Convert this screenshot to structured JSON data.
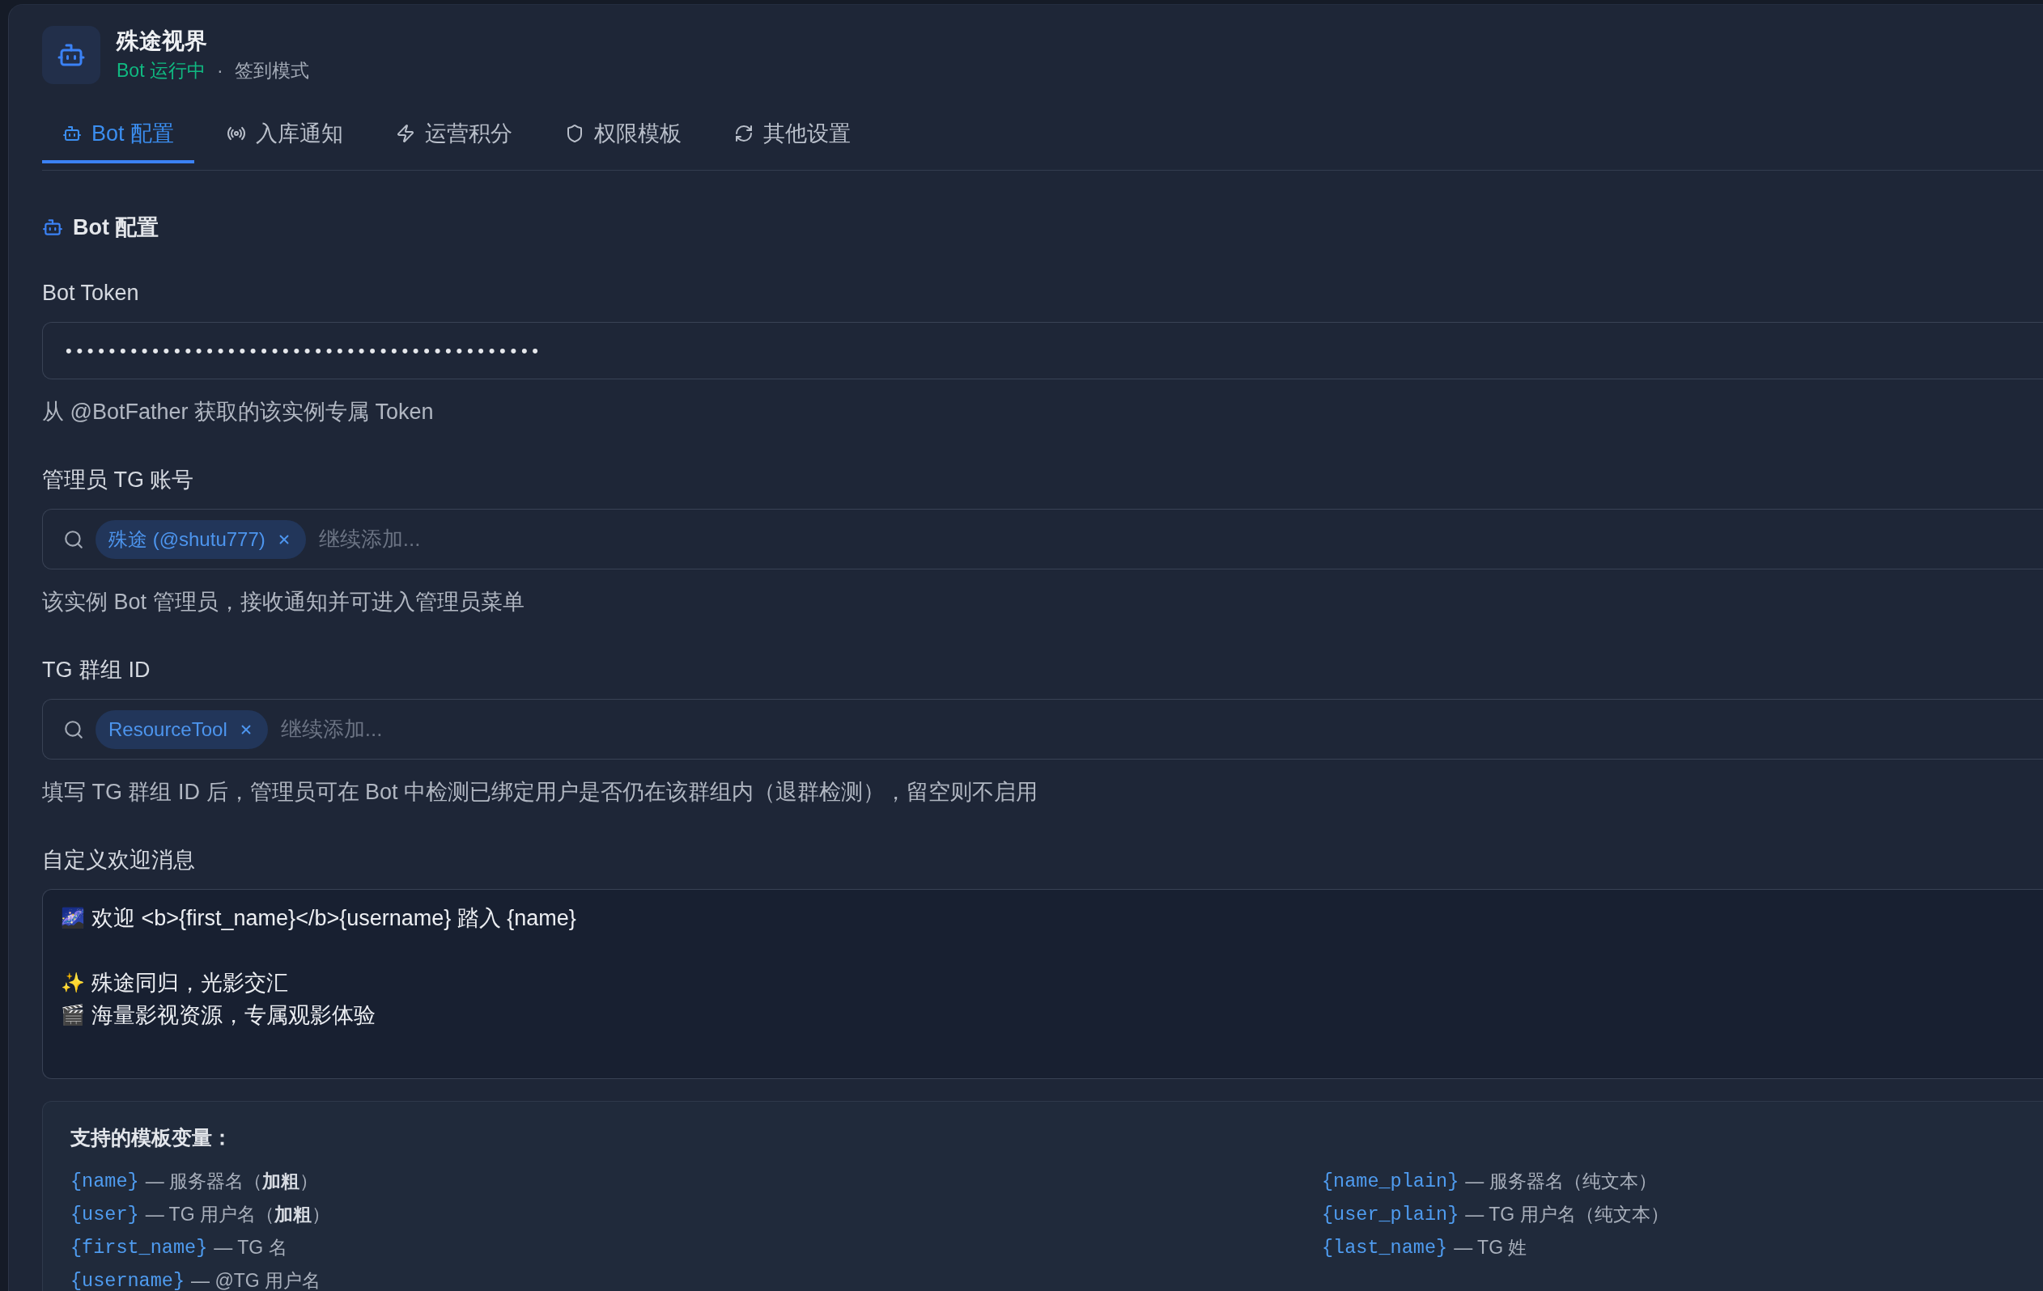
{
  "header": {
    "title": "殊途视界",
    "status": {
      "text": "Bot 运行中",
      "running": true
    },
    "separator": "·",
    "mode": "签到模式"
  },
  "tabs": [
    {
      "label": "Bot 配置",
      "selected": true
    },
    {
      "label": "入库通知",
      "selected": false
    },
    {
      "label": "运营积分",
      "selected": false
    },
    {
      "label": "权限模板",
      "selected": false
    },
    {
      "label": "其他设置",
      "selected": false
    }
  ],
  "section": {
    "title": "Bot 配置"
  },
  "fields": [
    {
      "kind": "secret",
      "label": "Bot Token",
      "value": "••••••••••••••••••••••••••••••••••••••••••••",
      "help": "从 @BotFather 获取的该实例专属 Token"
    },
    {
      "kind": "tags",
      "label": "管理员 TG 账号",
      "tags": [
        "殊途 (@shutu777)"
      ],
      "placeholder": "继续添加...",
      "help": "该实例 Bot 管理员，接收通知并可进入管理员菜单"
    },
    {
      "kind": "tags",
      "label": "TG 群组 ID",
      "tags": [
        "ResourceTool"
      ],
      "placeholder": "继续添加...",
      "help": "填写 TG 群组 ID 后，管理员可在 Bot 中检测已绑定用户是否仍在该群组内（退群检测），留空则不启用"
    },
    {
      "kind": "message",
      "label": "自定义欢迎消息",
      "paragraphs": [
        [
          {
            "emoji": "🌌",
            "text": "欢迎 <b>{first_name}</b>{username} 踏入 {name}"
          }
        ],
        [
          {
            "emoji": "✨",
            "text": "殊途同归，光影交汇"
          },
          {
            "emoji": "🎬",
            "text": "海量影视资源，专属观影体验"
          }
        ]
      ]
    }
  ],
  "variables": {
    "title": "支持的模板变量：",
    "columns": [
      [
        {
          "code": "{name}",
          "desc": "— 服务器名（**加粗**）"
        },
        {
          "code": "{user}",
          "desc": "— TG 用户名（**加粗**）"
        },
        {
          "code": "{first_name}",
          "desc": "— TG 名"
        },
        {
          "code": "{username}",
          "desc": "— @TG 用户名"
        }
      ],
      [
        {
          "code": "{name_plain}",
          "desc": "— 服务器名（纯文本）"
        },
        {
          "code": "{user_plain}",
          "desc": "— TG 用户名（纯文本）"
        },
        {
          "code": "{last_name}",
          "desc": "— TG 姓"
        }
      ]
    ]
  }
}
